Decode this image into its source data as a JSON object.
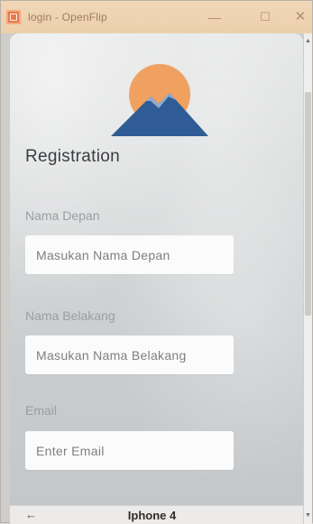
{
  "window": {
    "title": "login - OpenFlip",
    "minimize_glyph": "—",
    "maximize_glyph": "☐",
    "close_glyph": "✕"
  },
  "form": {
    "title": "Registration",
    "fields": [
      {
        "label": "Nama Depan",
        "placeholder": "Masukan Nama Depan",
        "value": ""
      },
      {
        "label": "Nama Belakang",
        "placeholder": "Masukan Nama Belakang",
        "value": ""
      },
      {
        "label": "Email",
        "placeholder": "Enter Email",
        "value": ""
      }
    ]
  },
  "footer": {
    "back_glyph": "←",
    "device_name": "Iphone 4"
  },
  "icons": {
    "logo": "mountain-sun-logo",
    "back": "arrow-left-icon"
  },
  "colors": {
    "sun": "#f0a160",
    "mountain": "#2f5c96",
    "titlebar": "#efd4b2"
  }
}
